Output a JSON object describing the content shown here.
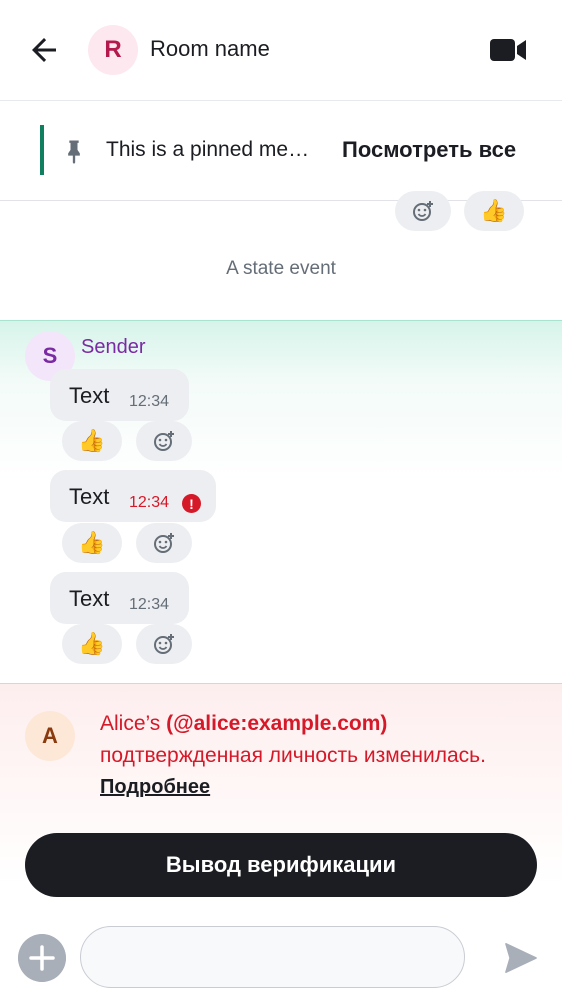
{
  "header": {
    "back_icon": "arrow-left-icon",
    "room_avatar_letter": "R",
    "room_name": "Room name",
    "video_icon": "video-call-icon"
  },
  "pinned": {
    "text": "This is a pinned me…",
    "view_all_label": "Посмотреть все"
  },
  "top_reactions": [
    {
      "icon": "add-reaction-icon"
    },
    {
      "emoji": "👍"
    }
  ],
  "state_event": "A state event",
  "sender": {
    "avatar_letter": "S",
    "name": "Sender"
  },
  "messages": [
    {
      "text": "Text",
      "time": "12:34",
      "error": false,
      "reaction": "👍"
    },
    {
      "text": "Text",
      "time": "12:34",
      "error": true,
      "reaction": "👍"
    },
    {
      "text": "Text",
      "time": "12:34",
      "error": false,
      "reaction": "👍"
    }
  ],
  "error_glyph": "!",
  "identity_alert": {
    "avatar_letter": "A",
    "name_prefix": "Alice’s",
    "user_id": "(@alice:example.com)",
    "message": "подтвержденная личность изменилась.",
    "link_label": "Подробнее",
    "button_label": "Вывод верификации"
  },
  "composer": {
    "placeholder": "",
    "plus_icon": "plus-icon",
    "send_icon": "send-icon"
  },
  "colors": {
    "accent_green": "#0f7f5f",
    "sender_purple": "#7a2aa3",
    "critical_red": "#d51928",
    "dark_button": "#1b1d22"
  }
}
